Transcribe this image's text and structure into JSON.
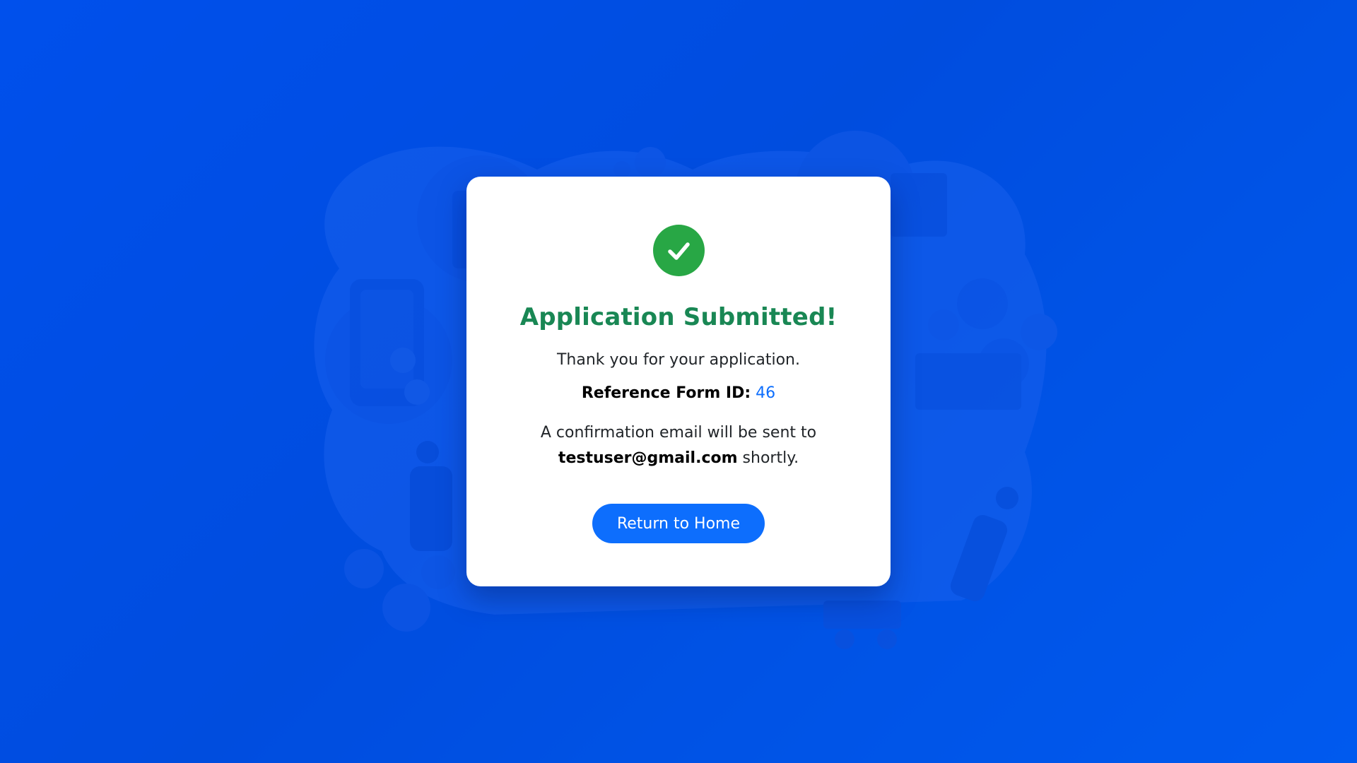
{
  "colors": {
    "background": "#0056f0",
    "card": "#ffffff",
    "success_green": "#28a745",
    "title_green": "#198754",
    "accent_blue": "#0d6efd"
  },
  "icons": {
    "success": "check-circle-icon"
  },
  "card": {
    "title": "Application Submitted!",
    "thanks_text": "Thank you for your application.",
    "reference_label": "Reference Form ID:",
    "reference_id": "46",
    "confirmation_prefix": "A confirmation email will be sent to",
    "email": "testuser@gmail.com",
    "confirmation_suffix": "shortly.",
    "button_label": "Return to Home"
  }
}
